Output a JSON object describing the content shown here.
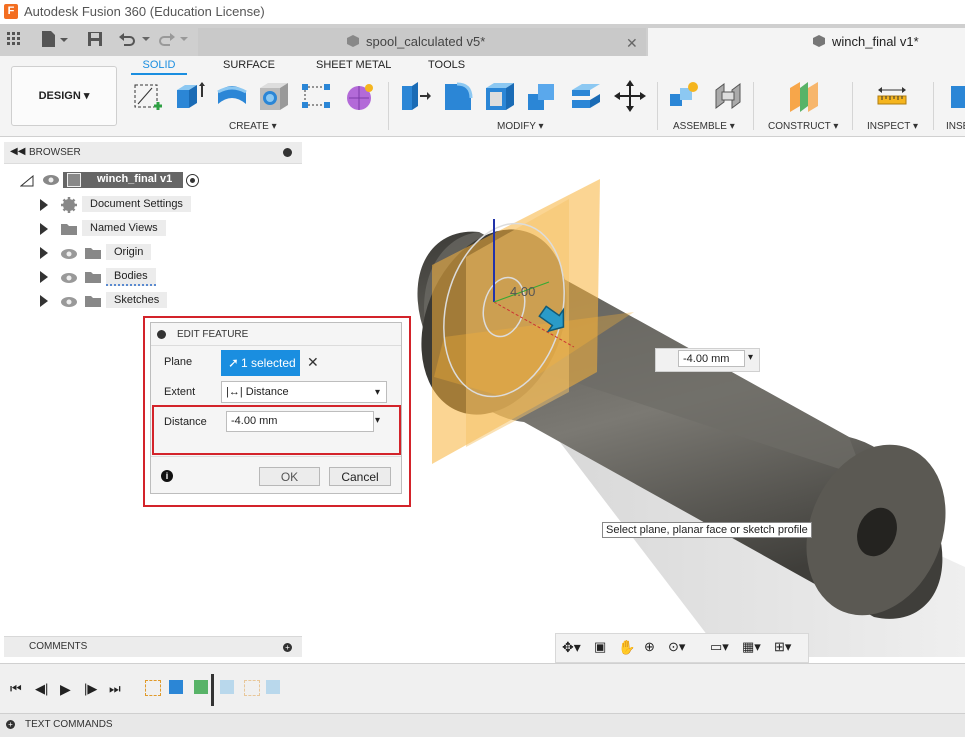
{
  "app": {
    "title": "Autodesk Fusion 360 (Education License)",
    "logo_letter": "F"
  },
  "tabs": [
    {
      "label": "spool_calculated v5*"
    },
    {
      "label": "winch_final v1*"
    }
  ],
  "toolbar": {
    "workspace": "DESIGN",
    "tabs": [
      "SOLID",
      "SURFACE",
      "SHEET METAL",
      "TOOLS"
    ],
    "groups": [
      "CREATE",
      "MODIFY",
      "ASSEMBLE",
      "CONSTRUCT",
      "INSPECT",
      "INSE"
    ]
  },
  "browser": {
    "title": "BROWSER",
    "root": "winch_final v1",
    "items": [
      "Document Settings",
      "Named Views",
      "Origin",
      "Bodies",
      "Sketches"
    ]
  },
  "edit_feature": {
    "title": "EDIT FEATURE",
    "plane_label": "Plane",
    "plane_value": "1 selected",
    "extent_label": "Extent",
    "extent_value": "Distance",
    "distance_label": "Distance",
    "distance_value": "-4.00 mm",
    "ok": "OK",
    "cancel": "Cancel"
  },
  "viewport": {
    "offset_label": "4.00",
    "distance_field": "-4.00 mm",
    "tooltip": "Select plane, planar face or sketch profile"
  },
  "comments": {
    "title": "COMMENTS"
  },
  "text_commands": {
    "title": "TEXT COMMANDS"
  },
  "colors": {
    "accent": "#1a8ee0",
    "highlight": "#d3232a",
    "plane": "#f7b23a"
  }
}
